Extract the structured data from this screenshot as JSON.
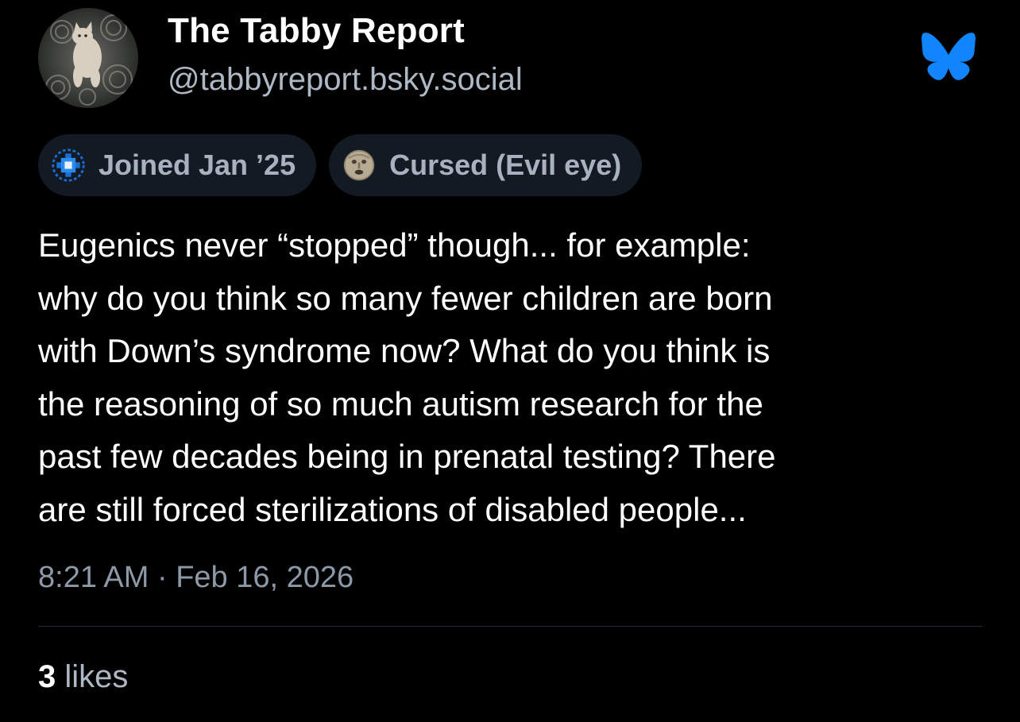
{
  "author": {
    "display_name": "The Tabby Report",
    "handle": "@tabbyreport.bsky.social",
    "avatar_icon": "cat-avatar"
  },
  "brand": {
    "icon": "bluesky-butterfly-icon",
    "color": "#1185fe"
  },
  "badges": [
    {
      "icon": "blue-pixel-badge-icon",
      "label": "Joined Jan ’25"
    },
    {
      "icon": "mouth-of-truth-badge-icon",
      "label": "Cursed (Evil eye)"
    }
  ],
  "post": {
    "text_lines": [
      "Eugenics never “stopped” though... for example:",
      "why do you think so many fewer children are born",
      "with Down’s syndrome now? What do you think is",
      "the reasoning of so much autism research for the",
      "past few decades being in prenatal testing? There",
      "are still forced sterilizations of disabled people..."
    ],
    "timestamp": "8:21 AM · Feb 16, 2026"
  },
  "stats": {
    "likes_count": "3",
    "likes_label": "likes"
  },
  "colors": {
    "background": "#000000",
    "badge_bg": "#141a23",
    "muted_text": "#aeb8c5"
  }
}
